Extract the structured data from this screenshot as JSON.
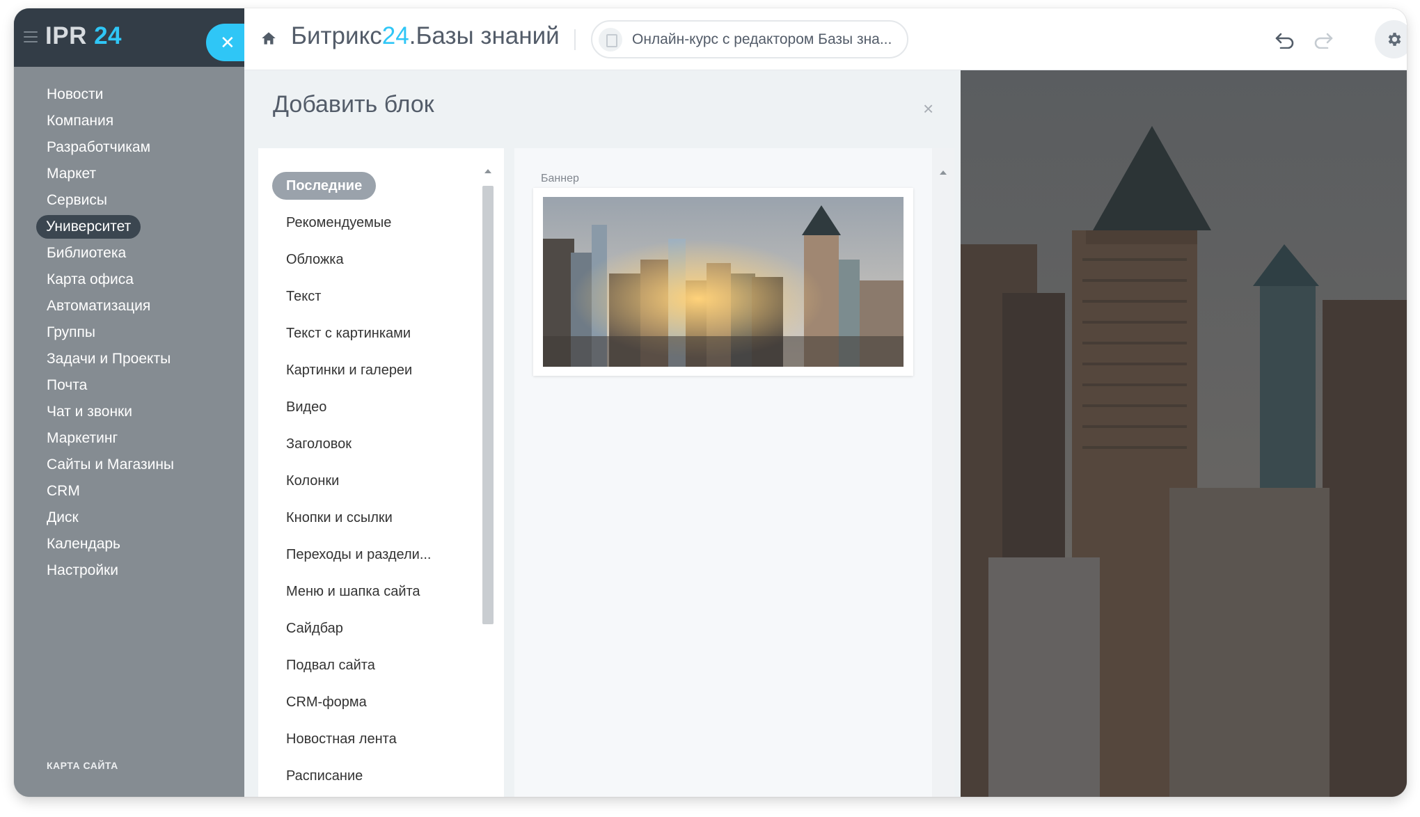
{
  "app": {
    "logo_main": "IPR",
    "logo_accent": "24"
  },
  "sidebar": {
    "items": [
      {
        "label": "Новости"
      },
      {
        "label": "Компания"
      },
      {
        "label": "Разработчикам"
      },
      {
        "label": "Маркет"
      },
      {
        "label": "Сервисы"
      },
      {
        "label": "Университет",
        "active": true
      },
      {
        "label": "Библиотека"
      },
      {
        "label": "Карта офиса"
      },
      {
        "label": "Автоматизация"
      },
      {
        "label": "Группы"
      },
      {
        "label": "Задачи и Проекты"
      },
      {
        "label": "Почта"
      },
      {
        "label": "Чат и звонки"
      },
      {
        "label": "Маркетинг"
      },
      {
        "label": "Сайты и Магазины"
      },
      {
        "label": "CRM"
      },
      {
        "label": "Диск"
      },
      {
        "label": "Календарь"
      },
      {
        "label": "Настройки"
      }
    ],
    "sitemap_label": "КАРТА САЙТА"
  },
  "header": {
    "title_prefix": "Битрикс",
    "title_accent": "24",
    "title_suffix": ".Базы знаний",
    "course_label": "Онлайн-курс с редактором Базы зна..."
  },
  "panel": {
    "title": "Добавить блок",
    "close_glyph": "×",
    "categories": [
      {
        "label": "Последние",
        "active": true
      },
      {
        "label": "Рекомендуемые"
      },
      {
        "label": "Обложка"
      },
      {
        "label": "Текст"
      },
      {
        "label": "Текст с картинками"
      },
      {
        "label": "Картинки и галереи"
      },
      {
        "label": "Видео"
      },
      {
        "label": "Заголовок"
      },
      {
        "label": "Колонки"
      },
      {
        "label": "Кнопки и ссылки"
      },
      {
        "label": "Переходы и раздели..."
      },
      {
        "label": "Меню и шапка сайта"
      },
      {
        "label": "Сайдбар"
      },
      {
        "label": "Подвал сайта"
      },
      {
        "label": "CRM-форма"
      },
      {
        "label": "Новостная лента"
      },
      {
        "label": "Расписание"
      }
    ],
    "block_label": "Баннер"
  },
  "colors": {
    "accent": "#2fc6f6",
    "sidebar_bg": "#858c92",
    "sidebar_header_bg": "#333d47",
    "active_nav_bg": "#3b4650",
    "active_category_bg": "#9aa2ab"
  },
  "icons": {
    "menu": "hamburger-icon",
    "close": "close-icon",
    "home": "home-icon",
    "document": "document-icon",
    "undo": "undo-icon",
    "redo": "redo-icon",
    "settings": "gear-icon"
  }
}
